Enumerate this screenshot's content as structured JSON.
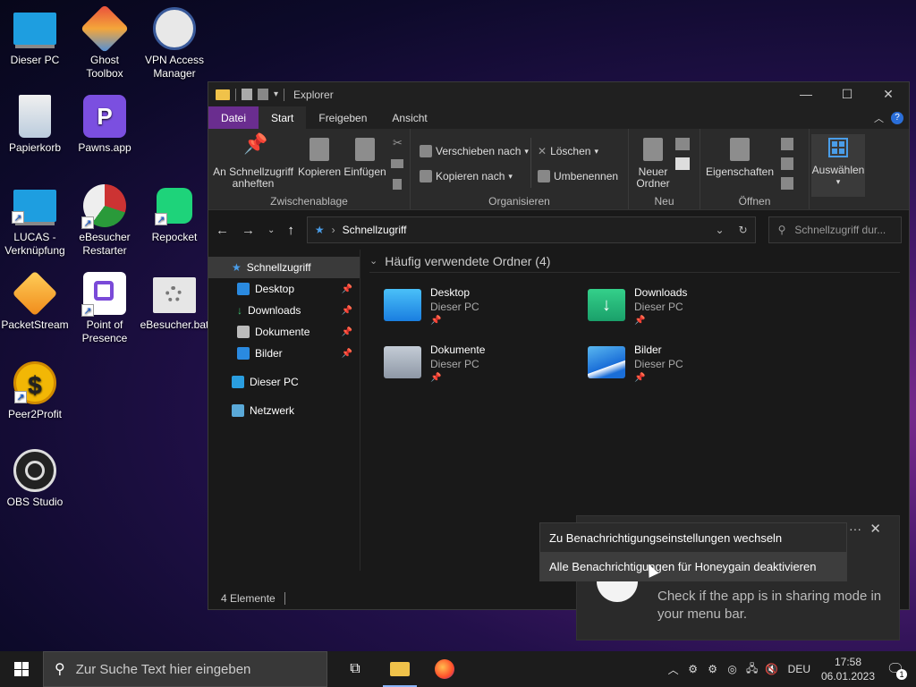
{
  "desktop": {
    "icons": [
      {
        "label": "Dieser PC"
      },
      {
        "label": "Ghost Toolbox"
      },
      {
        "label": "VPN Access Manager"
      },
      {
        "label": "Papierkorb"
      },
      {
        "label": "Pawns.app"
      },
      {
        "label": "LUCAS - Verknüpfung"
      },
      {
        "label": "eBesucher Restarter"
      },
      {
        "label": "Repocket"
      },
      {
        "label": "PacketStream"
      },
      {
        "label": "Point of Presence"
      },
      {
        "label": "eBesucher.bat"
      },
      {
        "label": "Peer2Profit"
      },
      {
        "label": "OBS Studio"
      }
    ]
  },
  "explorer": {
    "title": "Explorer",
    "tabs": [
      "Datei",
      "Start",
      "Freigeben",
      "Ansicht"
    ],
    "ribbon": {
      "pin_label": "An Schnellzugriff anheften",
      "copy_label": "Kopieren",
      "paste_label": "Einfügen",
      "group_clipboard": "Zwischenablage",
      "move_to": "Verschieben nach",
      "copy_to": "Kopieren nach",
      "delete": "Löschen",
      "rename": "Umbenennen",
      "group_organize": "Organisieren",
      "new_folder": "Neuer Ordner",
      "group_new": "Neu",
      "properties": "Eigenschaften",
      "group_open": "Öffnen",
      "select": "Auswählen"
    },
    "address": {
      "path": "Schnellzugriff",
      "search_placeholder": "Schnellzugriff dur..."
    },
    "nav": {
      "quick_access": "Schnellzugriff",
      "items": [
        "Desktop",
        "Downloads",
        "Dokumente",
        "Bilder"
      ],
      "this_pc": "Dieser PC",
      "network": "Netzwerk"
    },
    "section_title": "Häufig verwendete Ordner (4)",
    "folders": [
      {
        "name": "Desktop",
        "location": "Dieser PC"
      },
      {
        "name": "Downloads",
        "location": "Dieser PC"
      },
      {
        "name": "Dokumente",
        "location": "Dieser PC"
      },
      {
        "name": "Bilder",
        "location": "Dieser PC"
      }
    ],
    "status": "4 Elemente"
  },
  "notification": {
    "menu_items": [
      "Zu Benachrichtigungseinstellungen wechseln",
      "Alle Benachrichtigungen für Honeygain deaktivieren"
    ],
    "body": "Check if the app is in sharing mode in your menu bar."
  },
  "taskbar": {
    "search_placeholder": "Zur Suche Text hier eingeben",
    "language": "DEU",
    "time": "17:58",
    "date": "06.01.2023",
    "notif_count": "1"
  },
  "colors": {
    "accent": "#6a2d8f",
    "selection": "#3a3a3a",
    "help": "#2a6ed8"
  }
}
